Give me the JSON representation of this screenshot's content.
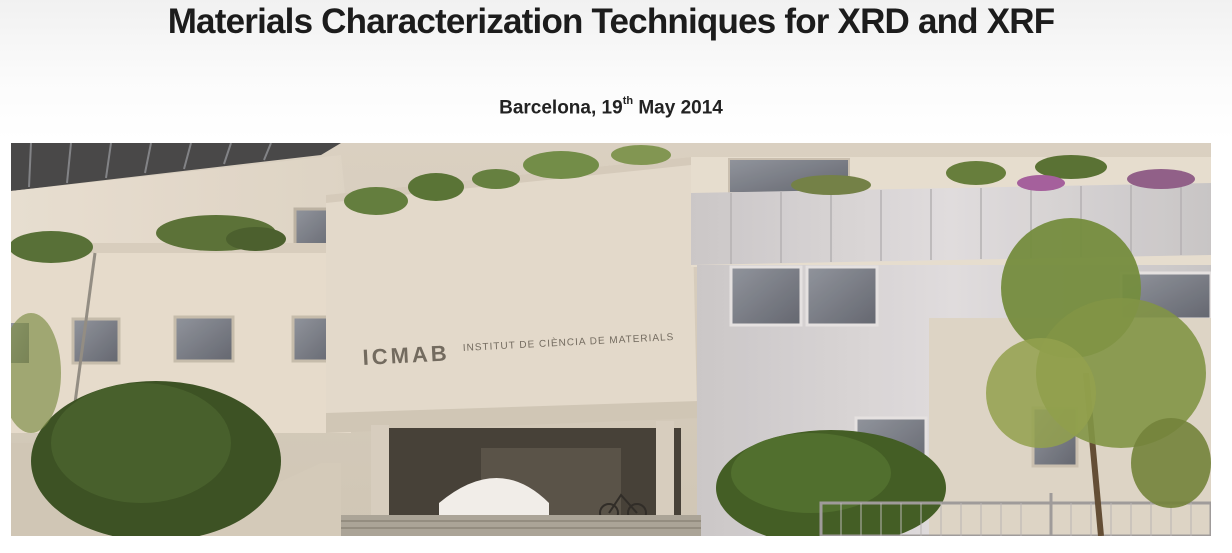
{
  "event": {
    "title": "Materials Characterization Techniques for XRD and XRF",
    "location": "Barcelona, 19",
    "date_suffix": "th",
    "date_rest": " May 2014"
  },
  "photo": {
    "sign_main": "ICMAB",
    "sign_sub": "INSTITUT DE CIÈNCIA DE MATERIALS"
  }
}
